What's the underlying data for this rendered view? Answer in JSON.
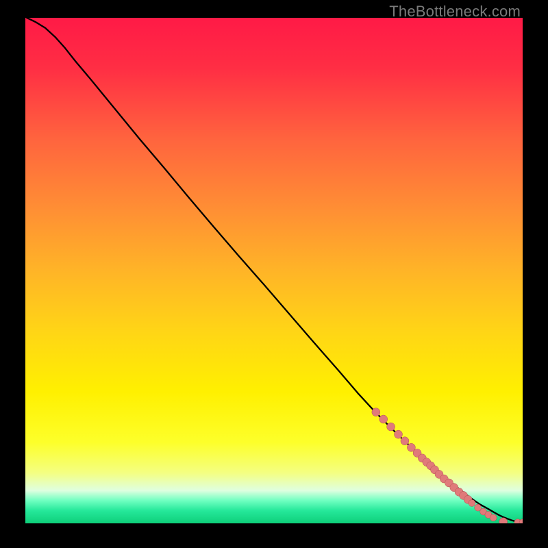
{
  "watermark": "TheBottleneck.com",
  "gradient_stops": [
    {
      "offset": 0.0,
      "color": "#ff1a46"
    },
    {
      "offset": 0.1,
      "color": "#ff2e44"
    },
    {
      "offset": 0.24,
      "color": "#ff643e"
    },
    {
      "offset": 0.38,
      "color": "#ff8f34"
    },
    {
      "offset": 0.5,
      "color": "#ffb427"
    },
    {
      "offset": 0.62,
      "color": "#ffd516"
    },
    {
      "offset": 0.74,
      "color": "#fff000"
    },
    {
      "offset": 0.84,
      "color": "#fdff2a"
    },
    {
      "offset": 0.9,
      "color": "#f4ff81"
    },
    {
      "offset": 0.935,
      "color": "#dfffe0"
    },
    {
      "offset": 0.955,
      "color": "#6fffc0"
    },
    {
      "offset": 0.975,
      "color": "#25e89a"
    },
    {
      "offset": 1.0,
      "color": "#0ecf7a"
    }
  ],
  "chart_data": {
    "type": "line",
    "title": "",
    "xlabel": "",
    "ylabel": "",
    "xlim": [
      0,
      100
    ],
    "ylim": [
      0,
      100
    ],
    "series": [
      {
        "name": "curve",
        "color": "#000000",
        "x": [
          0.3,
          2,
          4,
          6,
          8,
          10,
          13,
          18,
          23,
          28,
          33,
          38,
          43,
          48,
          53,
          58,
          63,
          67,
          70,
          73,
          76,
          79,
          81,
          83,
          85,
          87,
          88.5,
          90,
          91.5,
          93,
          94.2,
          95.3,
          96.2,
          97.1,
          97.8,
          98.4,
          99.0,
          99.6,
          100
        ],
        "y": [
          100,
          99.2,
          98.0,
          96.2,
          94,
          91.5,
          88,
          82,
          76,
          70.2,
          64.3,
          58.5,
          52.8,
          47.2,
          41.5,
          35.8,
          30.2,
          25.6,
          22.4,
          19.4,
          16.5,
          13.8,
          12.0,
          10.2,
          8.6,
          7.0,
          5.8,
          4.7,
          3.7,
          2.9,
          2.2,
          1.6,
          1.2,
          0.85,
          0.6,
          0.42,
          0.28,
          0.15,
          0.15
        ]
      }
    ],
    "dot_color": "#e07a7a",
    "dot_stroke": "#b34f4f",
    "dots": [
      {
        "x": 70.5,
        "y": 22.0,
        "r": 6
      },
      {
        "x": 72.0,
        "y": 20.6,
        "r": 6
      },
      {
        "x": 73.5,
        "y": 19.1,
        "r": 6
      },
      {
        "x": 75.0,
        "y": 17.6,
        "r": 6
      },
      {
        "x": 76.3,
        "y": 16.3,
        "r": 6
      },
      {
        "x": 77.6,
        "y": 15.0,
        "r": 6
      },
      {
        "x": 78.8,
        "y": 13.9,
        "r": 6
      },
      {
        "x": 79.8,
        "y": 12.9,
        "r": 6
      },
      {
        "x": 80.7,
        "y": 12.1,
        "r": 6
      },
      {
        "x": 81.5,
        "y": 11.4,
        "r": 6
      },
      {
        "x": 82.3,
        "y": 10.6,
        "r": 6
      },
      {
        "x": 83.2,
        "y": 9.7,
        "r": 6
      },
      {
        "x": 84.2,
        "y": 8.8,
        "r": 6
      },
      {
        "x": 85.2,
        "y": 8.0,
        "r": 6
      },
      {
        "x": 86.2,
        "y": 7.1,
        "r": 6
      },
      {
        "x": 87.2,
        "y": 6.2,
        "r": 6
      },
      {
        "x": 88.1,
        "y": 5.5,
        "r": 6
      },
      {
        "x": 89.0,
        "y": 4.7,
        "r": 6
      },
      {
        "x": 89.8,
        "y": 4.0,
        "r": 5
      },
      {
        "x": 91.0,
        "y": 3.1,
        "r": 5
      },
      {
        "x": 92.1,
        "y": 2.3,
        "r": 5
      },
      {
        "x": 93.1,
        "y": 1.7,
        "r": 5
      },
      {
        "x": 94.1,
        "y": 1.1,
        "r": 5
      },
      {
        "x": 96.1,
        "y": 0.3,
        "r": 6
      },
      {
        "x": 99.0,
        "y": 0.18,
        "r": 5
      },
      {
        "x": 100.0,
        "y": 0.18,
        "r": 5
      }
    ]
  }
}
